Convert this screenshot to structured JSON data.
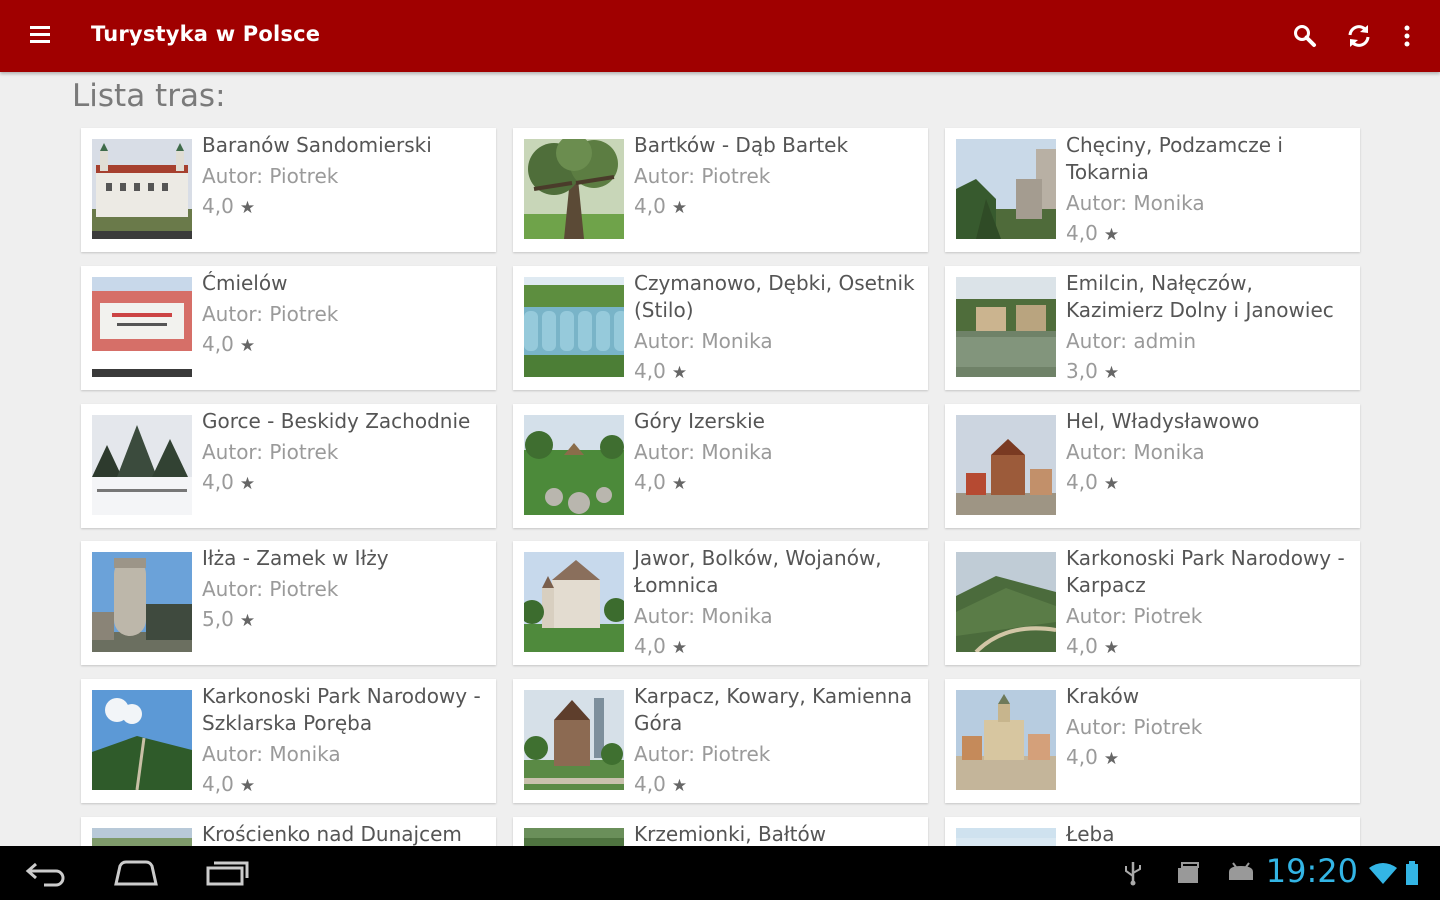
{
  "app": {
    "title": "Turystyka w Polsce",
    "accent_color": "#a00000"
  },
  "actions": [
    {
      "name": "search-icon"
    },
    {
      "name": "refresh-icon"
    },
    {
      "name": "overflow-menu-icon"
    }
  ],
  "list": {
    "heading": "Lista tras:",
    "author_prefix": "Autor: ",
    "routes": [
      {
        "name": "Baranów Sandomierski",
        "author": "Autor: Piotrek",
        "rating": "4,0"
      },
      {
        "name": "Bartków - Dąb Bartek",
        "author": "Autor: Piotrek",
        "rating": "4,0"
      },
      {
        "name": "Chęciny, Podzamcze i Tokarnia",
        "author": "Autor: Monika",
        "rating": "4,0"
      },
      {
        "name": "Ćmielów",
        "author": "Autor: Piotrek",
        "rating": "4,0"
      },
      {
        "name": "Czymanowo, Dębki, Osetnik (Stilo)",
        "author": "Autor: Monika",
        "rating": "4,0"
      },
      {
        "name": "Emilcin, Nałęczów, Kazimierz Dolny i Janowiec",
        "author": "Autor: admin",
        "rating": "3,0"
      },
      {
        "name": "Gorce - Beskidy Zachodnie",
        "author": "Autor: Piotrek",
        "rating": "4,0"
      },
      {
        "name": "Góry Izerskie",
        "author": "Autor: Monika",
        "rating": "4,0"
      },
      {
        "name": "Hel, Władysławowo",
        "author": "Autor: Monika",
        "rating": "4,0"
      },
      {
        "name": "Iłża - Zamek w Iłży",
        "author": "Autor: Piotrek",
        "rating": "5,0"
      },
      {
        "name": "Jawor, Bolków, Wojanów, Łomnica",
        "author": "Autor: Monika",
        "rating": "4,0"
      },
      {
        "name": "Karkonoski Park Narodowy - Karpacz",
        "author": "Autor: Piotrek",
        "rating": "4,0"
      },
      {
        "name": "Karkonoski Park Narodowy - Szklarska Poręba",
        "author": "Autor: Monika",
        "rating": "4,0"
      },
      {
        "name": "Karpacz, Kowary, Kamienna Góra",
        "author": "Autor: Piotrek",
        "rating": "4,0"
      },
      {
        "name": "Kraków",
        "author": "Autor: Piotrek",
        "rating": "4,0"
      },
      {
        "name": "Krościenko nad Dunajcem",
        "author": "",
        "rating": ""
      },
      {
        "name": "Krzemionki, Bałtów",
        "author": "",
        "rating": ""
      },
      {
        "name": "Łeba",
        "author": "",
        "rating": ""
      }
    ]
  },
  "status_bar": {
    "time": "19:20",
    "time_color": "#33b5e5"
  },
  "nav": [
    {
      "name": "back-icon"
    },
    {
      "name": "home-icon"
    },
    {
      "name": "recent-apps-icon"
    }
  ]
}
